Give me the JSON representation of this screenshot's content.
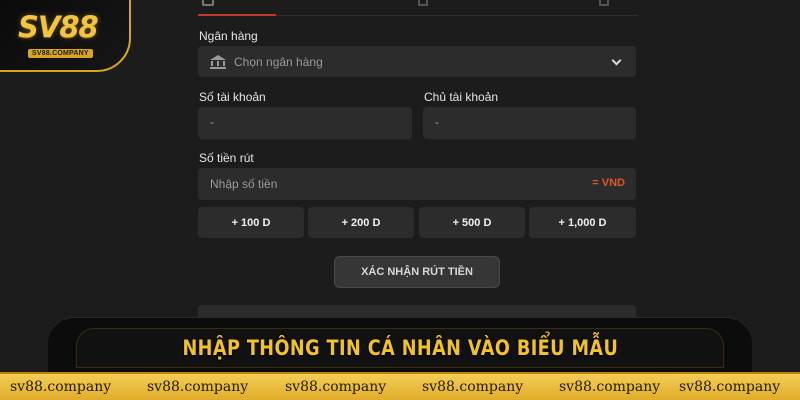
{
  "logo": {
    "brand": "SV88",
    "domain": "SV88.COMPANY"
  },
  "form": {
    "bank_label": "Ngân hàng",
    "bank_placeholder": "Chọn ngân hàng",
    "account_number_label": "Số tài khoản",
    "account_number_value": "-",
    "account_holder_label": "Chủ tài khoản",
    "account_holder_value": "-",
    "amount_label": "Số tiền rút",
    "amount_placeholder": "Nhập số tiền",
    "amount_unit": "= VND",
    "quick_amounts": [
      "+ 100 D",
      "+ 200 D",
      "+ 500 D",
      "+ 1,000 D"
    ],
    "confirm_label": "XÁC NHẬN RÚT TIỀN"
  },
  "banner": {
    "headline": "NHẬP THÔNG TIN CÁ NHÂN VÀO BIỂU MẪU"
  },
  "watermark": {
    "text": [
      "sv88.company",
      "sv88.company",
      "sv88.company",
      "sv88.company",
      "sv88.company",
      "sv88.company"
    ]
  },
  "colors": {
    "accent": "#e0562b",
    "gold": "#f2c12e",
    "field": "#2c2c2c",
    "background": "#1c1c1c"
  }
}
